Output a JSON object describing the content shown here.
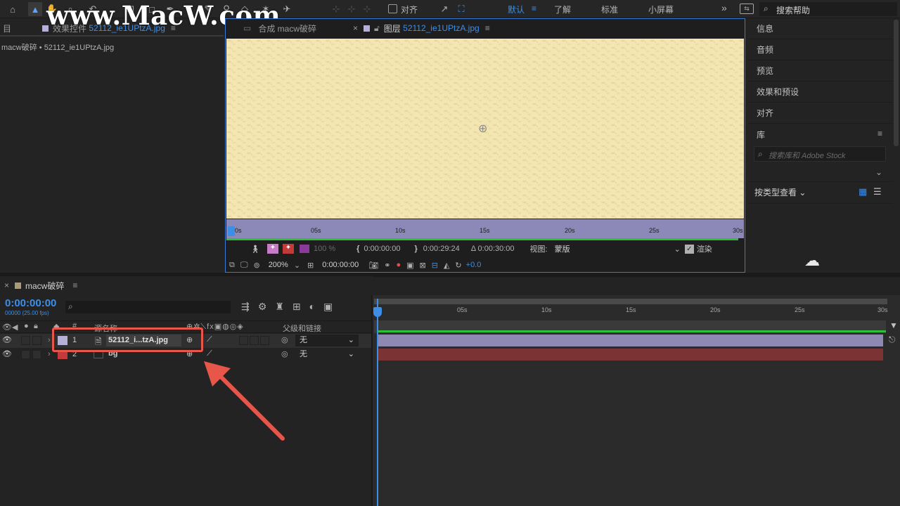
{
  "toolbar": {
    "align_label": "对齐",
    "workspaces": [
      "默认",
      "了解",
      "标准",
      "小屏幕"
    ],
    "more": "»",
    "search_help": "搜索帮助"
  },
  "watermark": "www.MacW.com",
  "left_panel": {
    "tab_prefix": "效果控件",
    "tab_file": "52112_ie1UPtzA.jpg",
    "breadcrumb": "macw破碎 • 52112_ie1UPtzA.jpg",
    "panel_letter": "目"
  },
  "viewer": {
    "tab1": "合成 macw破碎",
    "tab2_prefix": "图层",
    "tab2_file": "52112_ie1UPtzA.jpg",
    "ruler_ticks": [
      "0s",
      "05s",
      "10s",
      "15s",
      "20s",
      "25s",
      "30s"
    ],
    "opacity": "100 %",
    "in_time": "0:00:00:00",
    "out_time": "0:00:29:24",
    "duration": "Δ 0:00:30:00",
    "view_label": "视图:",
    "view_value": "蒙版",
    "render_label": "渲染",
    "zoom": "200%",
    "current_time": "0:00:00:00",
    "exposure": "+0.0"
  },
  "right_panel": {
    "items": [
      "信息",
      "音频",
      "预览",
      "效果和预设",
      "对齐"
    ],
    "library_title": "库",
    "library_search_placeholder": "搜索库和 Adobe Stock",
    "view_by_type": "按类型查看"
  },
  "timeline": {
    "comp_tab": "macw破碎",
    "timecode": "0:00:00:00",
    "frames_fps": "00000 (25.00 fps)",
    "col_source": "源名称",
    "col_parent": "父级和链接",
    "ruler_ticks": [
      "0s",
      "05s",
      "10s",
      "15s",
      "20s",
      "25s",
      "30s"
    ],
    "layers": [
      {
        "num": "1",
        "name": "52112_i...tzA.jpg",
        "parent": "无",
        "color": "#b4b0d8",
        "bar_color": "#8d89b3"
      },
      {
        "num": "2",
        "name": "bg",
        "parent": "无",
        "color": "#c23a3a",
        "bar_color": "#7b3333"
      }
    ]
  },
  "colors": {
    "accent": "#3d8ee6",
    "highlight": "#e8564a",
    "layer_lavender": "#b4b0d8",
    "layer_red": "#c23a3a",
    "canvas": "#f4e6b2"
  }
}
